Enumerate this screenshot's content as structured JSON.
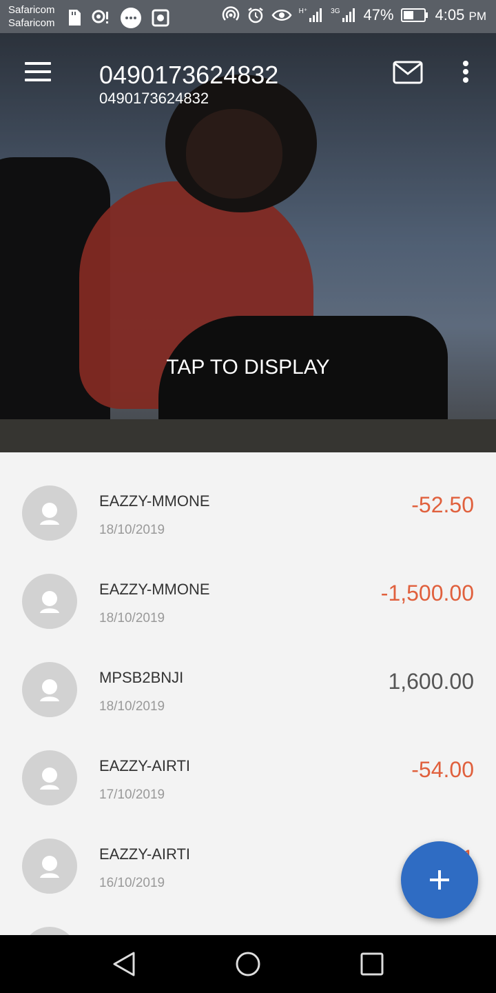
{
  "status_bar": {
    "carrier_1": "Safaricom",
    "carrier_2": "Safaricom",
    "network": "H⁺",
    "network_2": "3G",
    "battery": "47%",
    "time": "4:05",
    "ampm": "PM"
  },
  "header": {
    "title": "0490173624832",
    "subtitle": "0490173624832",
    "hero_prompt": "TAP TO DISPLAY"
  },
  "colors": {
    "negative": "#e0603d",
    "positive": "#555555",
    "fab": "#2f6cc3"
  },
  "transactions": [
    {
      "name": "EAZZY-MMONE",
      "date": "18/10/2019",
      "amount": "-52.50",
      "type": "debit"
    },
    {
      "name": "EAZZY-MMONE",
      "date": "18/10/2019",
      "amount": "-1,500.00",
      "type": "debit"
    },
    {
      "name": "MPSB2BNJI",
      "date": "18/10/2019",
      "amount": "1,600.00",
      "type": "credit"
    },
    {
      "name": "EAZZY-AIRTI",
      "date": "17/10/2019",
      "amount": "-54.00",
      "type": "debit"
    },
    {
      "name": "EAZZY-AIRTI",
      "date": "16/10/2019",
      "amount": "-1",
      "type": "debit"
    }
  ],
  "icons": {
    "menu": "hamburger-icon",
    "mail": "envelope-icon",
    "more": "vertical-dots-icon",
    "fab": "plus-icon",
    "avatar": "person-placeholder-icon",
    "back": "triangle-back-icon",
    "home": "circle-home-icon",
    "recents": "square-recents-icon"
  }
}
